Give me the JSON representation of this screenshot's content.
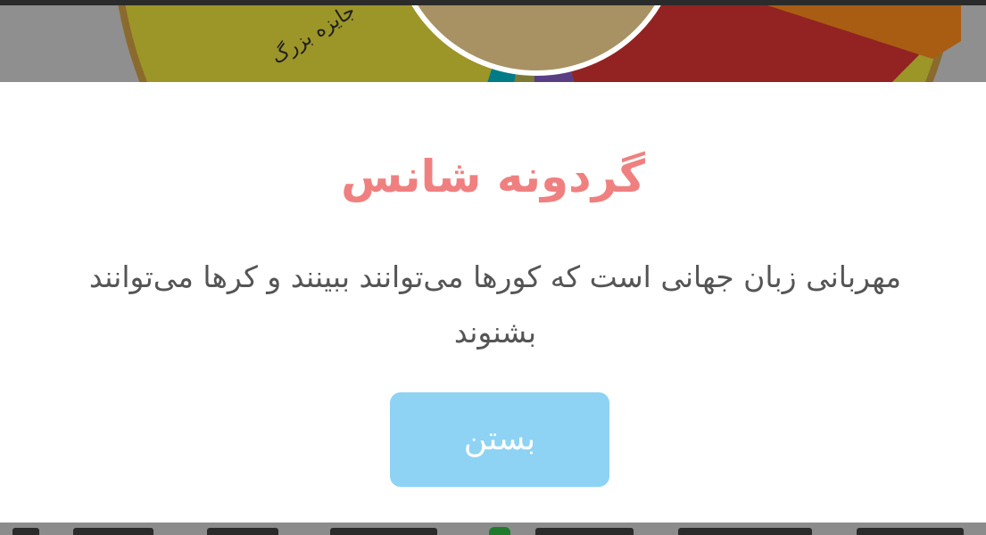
{
  "wheel": {
    "visible_segment_label": "جایزه بزرگ",
    "colors": {
      "rim": "#8b6a2e",
      "yellow": "#9c9528",
      "teal": "#007c86",
      "olive": "#7c7a35",
      "purple": "#5a3e84",
      "red": "#922322",
      "orange": "#a95d12",
      "hub": "#a89163"
    }
  },
  "dialog": {
    "title": "گردونه شانس",
    "message": "مهربانی زبان جهانی است که کورها می‌توانند ببینند و کرها می‌توانند بشنوند",
    "close_button_label": "بستن",
    "title_color": "#f08080",
    "button_color": "#8ed3f4"
  }
}
